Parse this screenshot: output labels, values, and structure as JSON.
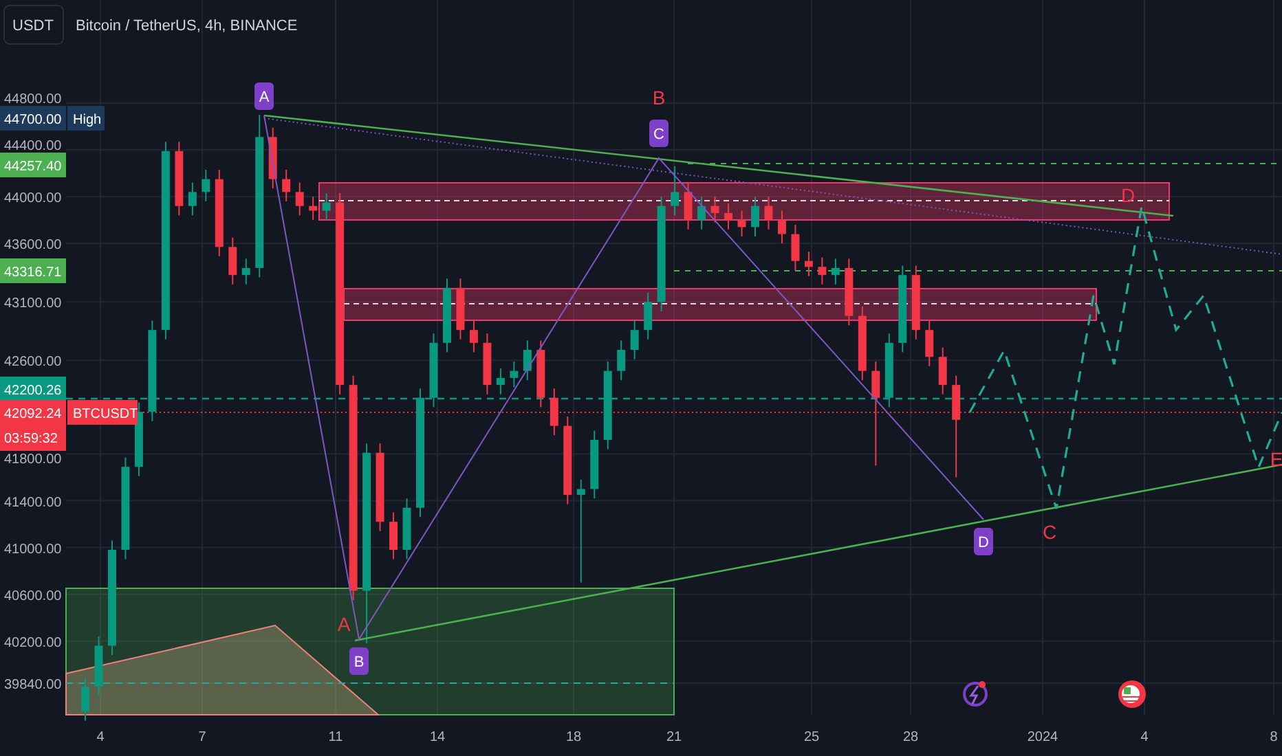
{
  "symbol_box": {
    "label": "USDT"
  },
  "title": "Bitcoin / TetherUS, 4h, BINANCE",
  "chart_data": {
    "type": "candlestick",
    "ohlc": [
      [
        39600,
        39890,
        39520,
        39810
      ],
      [
        39810,
        40240,
        39730,
        40160
      ],
      [
        40160,
        41060,
        40080,
        40980
      ],
      [
        40980,
        41770,
        40900,
        41690
      ],
      [
        41690,
        42240,
        41610,
        42160
      ],
      [
        42160,
        42940,
        42080,
        42860
      ],
      [
        42860,
        44470,
        42780,
        44390
      ],
      [
        44390,
        44470,
        43840,
        43920
      ],
      [
        43920,
        44120,
        43840,
        44040
      ],
      [
        44040,
        44230,
        43960,
        44150
      ],
      [
        44150,
        44230,
        43490,
        43570
      ],
      [
        43570,
        43650,
        43250,
        43330
      ],
      [
        43330,
        43470,
        43250,
        43390
      ],
      [
        43390,
        44700,
        43310,
        44510
      ],
      [
        44510,
        44590,
        44070,
        44150
      ],
      [
        44150,
        44230,
        43960,
        44040
      ],
      [
        44040,
        44120,
        43840,
        43920
      ],
      [
        43920,
        44000,
        43800,
        43880
      ],
      [
        43880,
        44030,
        43800,
        43950
      ],
      [
        43950,
        44030,
        42310,
        42390
      ],
      [
        42390,
        42470,
        40550,
        40630
      ],
      [
        40630,
        41890,
        40180,
        41810
      ],
      [
        41810,
        41890,
        41140,
        41220
      ],
      [
        41220,
        41300,
        40900,
        40980
      ],
      [
        40980,
        41420,
        40900,
        41340
      ],
      [
        41340,
        42360,
        41260,
        42280
      ],
      [
        42280,
        42830,
        42200,
        42750
      ],
      [
        42750,
        43300,
        42670,
        43220
      ],
      [
        43220,
        43300,
        42780,
        42860
      ],
      [
        42860,
        42940,
        42670,
        42750
      ],
      [
        42750,
        42830,
        42310,
        42390
      ],
      [
        42390,
        42530,
        42310,
        42450
      ],
      [
        42450,
        42590,
        42370,
        42510
      ],
      [
        42510,
        42770,
        42430,
        42690
      ],
      [
        42690,
        42770,
        42200,
        42280
      ],
      [
        42280,
        42360,
        41960,
        42040
      ],
      [
        42040,
        42120,
        41370,
        41450
      ],
      [
        41450,
        41580,
        40700,
        41500
      ],
      [
        41500,
        42000,
        41420,
        41920
      ],
      [
        41920,
        42590,
        41840,
        42510
      ],
      [
        42510,
        42770,
        42430,
        42690
      ],
      [
        42690,
        42940,
        42610,
        42860
      ],
      [
        42860,
        43180,
        42780,
        43100
      ],
      [
        43100,
        44000,
        43020,
        43920
      ],
      [
        43920,
        44260,
        43840,
        44040
      ],
      [
        44040,
        44120,
        43720,
        43800
      ],
      [
        43800,
        44000,
        43720,
        43920
      ],
      [
        43920,
        44000,
        43780,
        43860
      ],
      [
        43860,
        43940,
        43720,
        43800
      ],
      [
        43800,
        43880,
        43660,
        43740
      ],
      [
        43740,
        44000,
        43660,
        43920
      ],
      [
        43920,
        44000,
        43720,
        43800
      ],
      [
        43800,
        43880,
        43600,
        43680
      ],
      [
        43680,
        43760,
        43370,
        43450
      ],
      [
        43450,
        43530,
        43320,
        43400
      ],
      [
        43400,
        43480,
        43250,
        43330
      ],
      [
        43330,
        43470,
        43250,
        43390
      ],
      [
        43390,
        43470,
        42900,
        42980
      ],
      [
        42980,
        43060,
        42430,
        42510
      ],
      [
        42510,
        42590,
        41700,
        42280
      ],
      [
        42280,
        42830,
        42200,
        42750
      ],
      [
        42750,
        43410,
        42670,
        43330
      ],
      [
        43330,
        43410,
        42780,
        42860
      ],
      [
        42860,
        42940,
        42550,
        42630
      ],
      [
        42630,
        42710,
        42310,
        42390
      ],
      [
        42390,
        42470,
        41600,
        42092
      ]
    ],
    "yticks": [
      {
        "value": 44800,
        "label": "44800.00"
      },
      {
        "value": 44400,
        "label": "44400.00"
      },
      {
        "value": 44000,
        "label": "44000.00"
      },
      {
        "value": 43600,
        "label": "43600.00"
      },
      {
        "value": 43100,
        "label": "43100.00"
      },
      {
        "value": 42600,
        "label": "42600.00"
      },
      {
        "value": 41800,
        "label": "41800.00"
      },
      {
        "value": 41400,
        "label": "41400.00"
      },
      {
        "value": 41000,
        "label": "41000.00"
      },
      {
        "value": 40600,
        "label": "40600.00"
      },
      {
        "value": 40200,
        "label": "40200.00"
      },
      {
        "value": 39840,
        "label": "39840.00"
      }
    ],
    "ylim": [
      39840,
      44800
    ]
  },
  "time_axis": [
    "4",
    "7",
    "11",
    "14",
    "18",
    "21",
    "25",
    "28",
    "2024",
    "4",
    "8"
  ],
  "price_badges": [
    {
      "kind": "high",
      "value": "44700.00",
      "tag": "High",
      "color": "#1e3a5a"
    },
    {
      "kind": "level",
      "value": "44257.40",
      "color": "#4caf50"
    },
    {
      "kind": "level",
      "value": "43316.71",
      "color": "#4caf50"
    },
    {
      "kind": "level",
      "value": "42200.26",
      "color": "#089981"
    },
    {
      "kind": "last",
      "value": "42092.24",
      "countdown": "03:59:32",
      "tag": "BTCUSDT",
      "color": "#f23645"
    }
  ],
  "pattern_points": [
    "A",
    "C",
    "B",
    "D"
  ],
  "wave_labels": [
    "B",
    "D",
    "A",
    "C",
    "E"
  ]
}
